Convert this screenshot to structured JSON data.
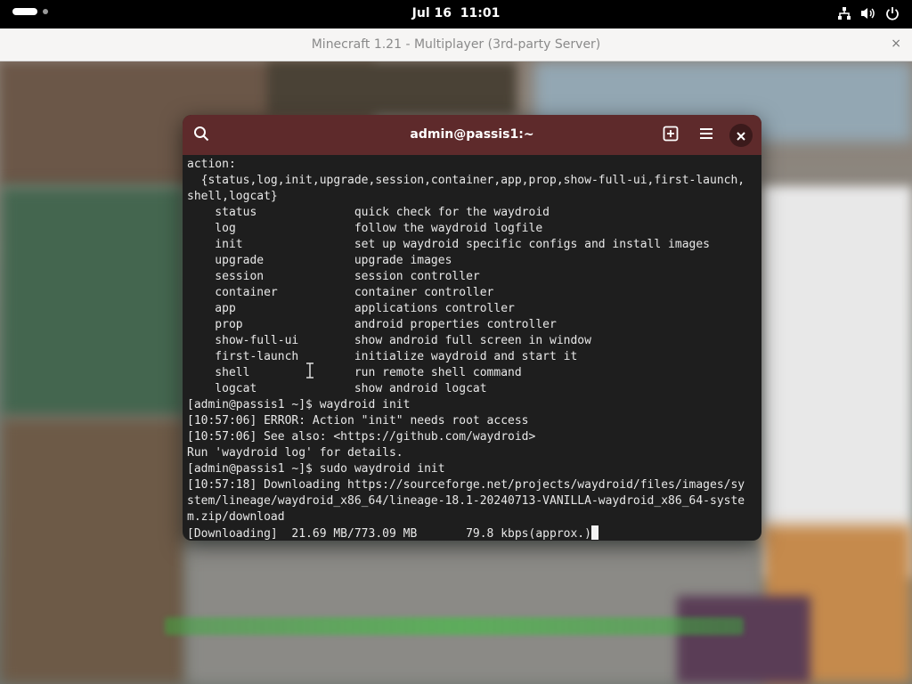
{
  "topbar": {
    "date": "Jul 16",
    "time": "11:01",
    "icons": [
      "network-icon",
      "volume-icon",
      "power-icon"
    ]
  },
  "game_window": {
    "title": "Minecraft 1.21 - Multiplayer (3rd-party Server)",
    "close_glyph": "×"
  },
  "terminal": {
    "title": "admin@passis1:~",
    "header_icons": [
      "search-icon",
      "new-tab-icon",
      "menu-icon",
      "close-icon"
    ],
    "lines": [
      "action:",
      "  {status,log,init,upgrade,session,container,app,prop,show-full-ui,first-launch,",
      "shell,logcat}",
      "    status              quick check for the waydroid",
      "    log                 follow the waydroid logfile",
      "    init                set up waydroid specific configs and install images",
      "    upgrade             upgrade images",
      "    session             session controller",
      "    container           container controller",
      "    app                 applications controller",
      "    prop                android properties controller",
      "    show-full-ui        show android full screen in window",
      "    first-launch        initialize waydroid and start it",
      "    shell               run remote shell command",
      "    logcat              show android logcat",
      "[admin@passis1 ~]$ waydroid init",
      "[10:57:06] ERROR: Action \"init\" needs root access",
      "[10:57:06] See also: <https://github.com/waydroid>",
      "Run 'waydroid log' for details.",
      "[admin@passis1 ~]$ sudo waydroid init",
      "[10:57:18] Downloading https://sourceforge.net/projects/waydroid/files/images/sy",
      "stem/lineage/waydroid_x86_64/lineage-18.1-20240713-VANILLA-waydroid_x86_64-syste",
      "m.zip/download",
      "[Downloading]  21.69 MB/773.09 MB       79.8 kbps(approx.)"
    ]
  },
  "colors": {
    "terminal_header": "#5e2a2b",
    "terminal_bg": "#1e1e1e",
    "terminal_fg": "#e8e8e8"
  }
}
